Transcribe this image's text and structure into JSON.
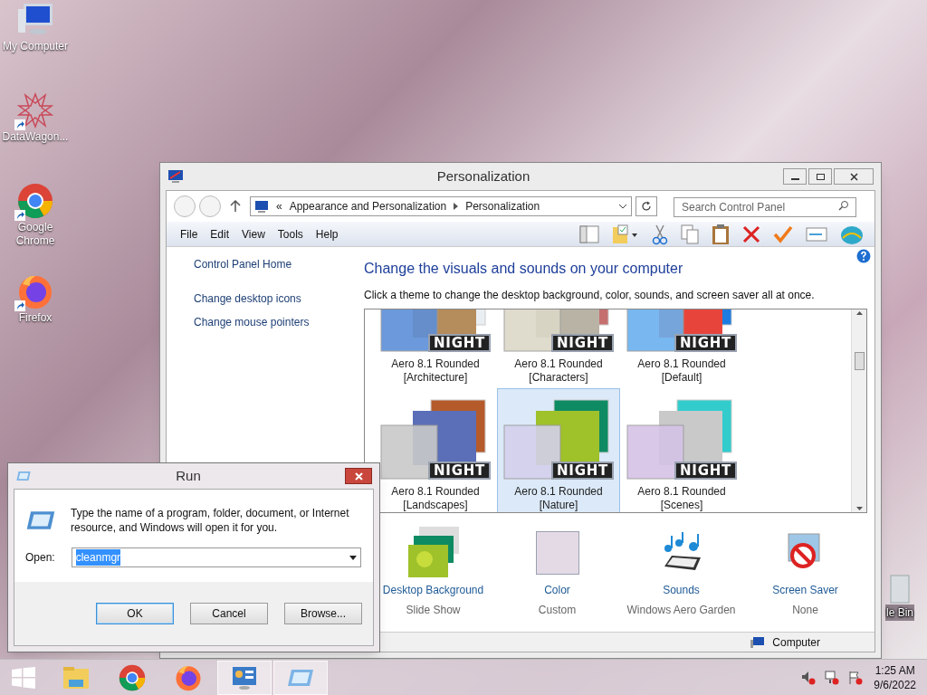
{
  "desktop_icons": [
    {
      "label": "My Computer",
      "kind": "computer"
    },
    {
      "label": "DataWagon...",
      "kind": "star"
    },
    {
      "label": "Google Chrome",
      "kind": "chrome"
    },
    {
      "label": "Firefox",
      "kind": "firefox"
    }
  ],
  "recycle_bin": {
    "label": "le Bin"
  },
  "personalization": {
    "title": "Personalization",
    "breadcrumb": [
      "«",
      "Appearance and Personalization",
      "Personalization"
    ],
    "search": {
      "placeholder": "Search Control Panel"
    },
    "menu": [
      "File",
      "Edit",
      "View",
      "Tools",
      "Help"
    ],
    "sidebar": [
      "Control Panel Home",
      "Change desktop icons",
      "Change mouse pointers"
    ],
    "heading": "Change the visuals and sounds on your computer",
    "description": "Click a theme to change the desktop background, color, sounds, and screen saver all at once.",
    "themes": [
      {
        "name": "Aero 8.1 Rounded",
        "variant": "[Architecture]",
        "badge": "NIGHT",
        "selected": false
      },
      {
        "name": "Aero 8.1 Rounded",
        "variant": "[Characters]",
        "badge": "NIGHT",
        "selected": false
      },
      {
        "name": "Aero 8.1 Rounded",
        "variant": "[Default]",
        "badge": "NIGHT",
        "selected": false
      },
      {
        "name": "Aero 8.1 Rounded",
        "variant": "[Landscapes]",
        "badge": "NIGHT",
        "selected": false
      },
      {
        "name": "Aero 8.1 Rounded",
        "variant": "[Nature]",
        "badge": "NIGHT",
        "selected": true
      },
      {
        "name": "Aero 8.1 Rounded",
        "variant": "[Scenes]",
        "badge": "NIGHT",
        "selected": false
      }
    ],
    "settings": [
      {
        "kind": "background",
        "label": "Desktop Background",
        "value": "Slide Show"
      },
      {
        "kind": "color",
        "label": "Color",
        "value": "Custom",
        "color": "#e4dae6"
      },
      {
        "kind": "sounds",
        "label": "Sounds",
        "value": "Windows Aero Garden"
      },
      {
        "kind": "screensaver",
        "label": "Screen Saver",
        "value": "None"
      }
    ],
    "status_bar": "Computer"
  },
  "run": {
    "title": "Run",
    "message": "Type the name of a program, folder, document, or Internet resource, and Windows will open it for you.",
    "open_label": "Open:",
    "value": "cleanmgr",
    "value_selected": true,
    "buttons": [
      {
        "label": "OK",
        "default": true
      },
      {
        "label": "Cancel",
        "default": false
      },
      {
        "label": "Browse...",
        "default": false
      }
    ]
  },
  "taskbar": {
    "apps": [
      {
        "kind": "explorer",
        "open": false
      },
      {
        "kind": "chrome",
        "open": false
      },
      {
        "kind": "firefox",
        "open": false
      },
      {
        "kind": "controlpanel",
        "open": true
      },
      {
        "kind": "run",
        "open": true
      }
    ],
    "time": "1:25 AM",
    "date": "9/6/2022"
  }
}
